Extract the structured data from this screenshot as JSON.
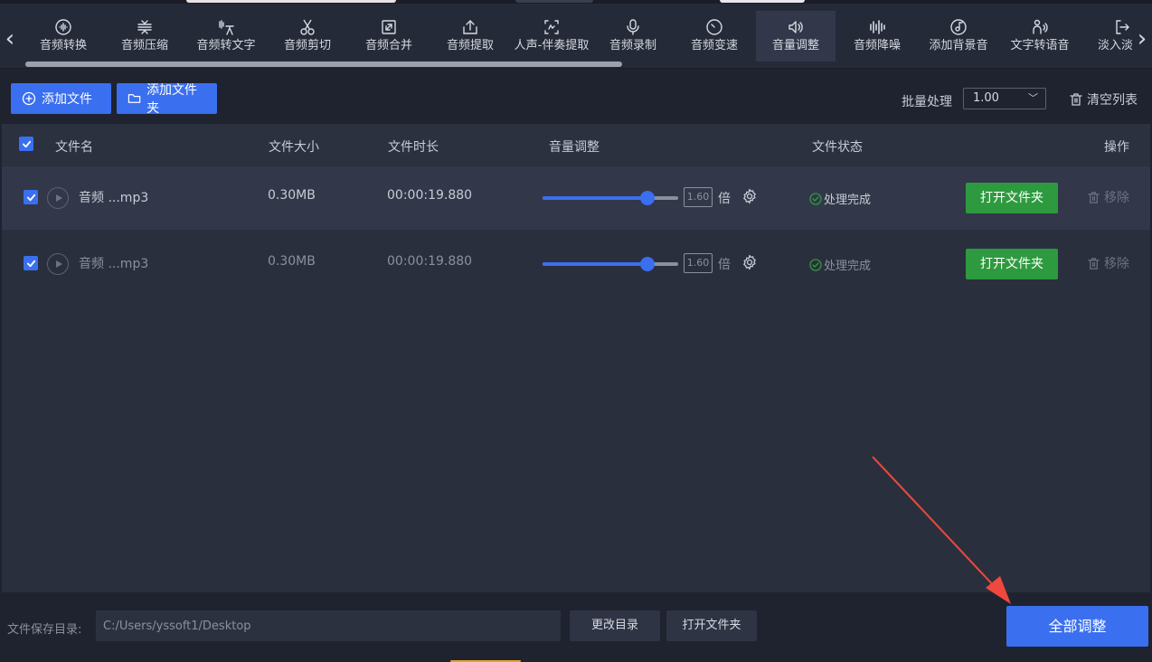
{
  "toolbar": {
    "items": [
      {
        "label": "音频转换",
        "icon": "waveform-circle-icon"
      },
      {
        "label": "音频压缩",
        "icon": "compress-icon"
      },
      {
        "label": "音频转文字",
        "icon": "speech-to-text-icon"
      },
      {
        "label": "音频剪切",
        "icon": "scissors-icon"
      },
      {
        "label": "音频合并",
        "icon": "merge-icon"
      },
      {
        "label": "音频提取",
        "icon": "upload-icon"
      },
      {
        "label": "人声-伴奏提取",
        "icon": "vocal-separate-icon"
      },
      {
        "label": "音频录制",
        "icon": "microphone-icon"
      },
      {
        "label": "音频变速",
        "icon": "speedometer-icon"
      },
      {
        "label": "音量调整",
        "icon": "speaker-icon"
      },
      {
        "label": "音频降噪",
        "icon": "noise-bars-icon"
      },
      {
        "label": "添加背景音",
        "icon": "music-disc-icon"
      },
      {
        "label": "文字转语音",
        "icon": "text-to-speech-icon"
      },
      {
        "label": "淡入淡出",
        "icon": "fade-icon"
      }
    ],
    "active_index": 9
  },
  "actions": {
    "add_file": "添加文件",
    "add_folder": "添加文件夹",
    "batch_label": "批量处理",
    "batch_value": "1.00",
    "clear_list": "清空列表"
  },
  "table": {
    "headers": {
      "name": "文件名",
      "size": "文件大小",
      "duration": "文件时长",
      "volume": "音量调整",
      "status": "文件状态",
      "ops": "操作"
    },
    "rows": [
      {
        "name": "音频 ...mp3",
        "size": "0.30MB",
        "duration": "00:00:19.880",
        "volume": "1.60",
        "volume_fraction": 0.77,
        "times": "倍",
        "status": "处理完成",
        "open_folder": "打开文件夹",
        "remove": "移除"
      },
      {
        "name": "音频 ...mp3",
        "size": "0.30MB",
        "duration": "00:00:19.880",
        "volume": "1.60",
        "volume_fraction": 0.77,
        "times": "倍",
        "status": "处理完成",
        "open_folder": "打开文件夹",
        "remove": "移除"
      }
    ]
  },
  "bottom": {
    "save_label": "文件保存目录:",
    "save_path": "C:/Users/yssoft1/Desktop",
    "change_dir": "更改目录",
    "open_folder": "打开文件夹",
    "run_all": "全部调整"
  },
  "colors": {
    "accent": "#3a6ff0",
    "success": "#2e9a3f",
    "annotation_arrow": "#f0483e"
  }
}
